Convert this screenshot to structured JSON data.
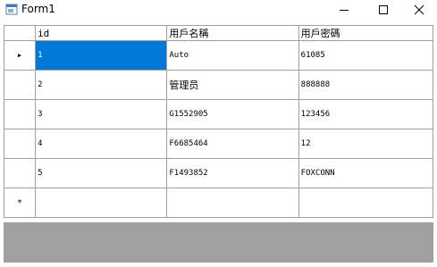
{
  "window": {
    "title": "Form1",
    "icon": "winforms-app-icon",
    "controls": [
      "minimize-icon",
      "maximize-icon",
      "close-icon"
    ]
  },
  "grid": {
    "columns": [
      "id",
      "用戶名稱",
      "用戶密碼"
    ],
    "rows": [
      {
        "id": "1",
        "name": "Auto",
        "password": "61085",
        "current": true
      },
      {
        "id": "2",
        "name": "管理员",
        "password": "888888",
        "current": false
      },
      {
        "id": "3",
        "name": "G1552905",
        "password": "123456",
        "current": false
      },
      {
        "id": "4",
        "name": "F6685464",
        "password": "12",
        "current": false
      },
      {
        "id": "5",
        "name": "F1493852",
        "password": "FOXCONN",
        "current": false
      }
    ],
    "current_row_glyph": "▶",
    "new_row_glyph": "*",
    "selection_color": "#0078d7",
    "background_color": "#a0a0a0"
  }
}
